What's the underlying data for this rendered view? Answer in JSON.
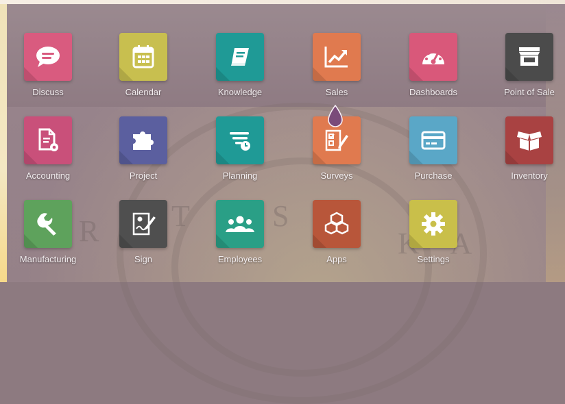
{
  "apps": [
    {
      "label": "Discuss",
      "icon": "chat-bubble-icon",
      "color": "#d95b7f"
    },
    {
      "label": "Calendar",
      "icon": "calendar-icon",
      "color": "#c8bf4f"
    },
    {
      "label": "Knowledge",
      "icon": "book-icon",
      "color": "#1f9a96"
    },
    {
      "label": "Sales",
      "icon": "chart-trend-icon",
      "color": "#e07a4f"
    },
    {
      "label": "Dashboards",
      "icon": "gauge-icon",
      "color": "#d9587a"
    },
    {
      "label": "Point of Sale",
      "icon": "store-icon",
      "color": "#4b4b4b"
    },
    {
      "label": "Accounting",
      "icon": "document-gear-icon",
      "color": "#c9507a"
    },
    {
      "label": "Project",
      "icon": "puzzle-icon",
      "color": "#5b5f9f"
    },
    {
      "label": "Planning",
      "icon": "planning-icon",
      "color": "#1f9a96"
    },
    {
      "label": "Surveys",
      "icon": "checklist-icon",
      "color": "#e07a4f"
    },
    {
      "label": "Purchase",
      "icon": "credit-card-icon",
      "color": "#5aa7c7"
    },
    {
      "label": "Inventory",
      "icon": "box-icon",
      "color": "#a94242"
    },
    {
      "label": "Manufacturing",
      "icon": "wrench-icon",
      "color": "#5ea25c"
    },
    {
      "label": "Sign",
      "icon": "sign-document-icon",
      "color": "#4f4f4f"
    },
    {
      "label": "Employees",
      "icon": "people-icon",
      "color": "#2a9f86"
    },
    {
      "label": "Apps",
      "icon": "cubes-icon",
      "color": "#b8563a"
    },
    {
      "label": "Settings",
      "icon": "gear-icon",
      "color": "#c9bf4a"
    }
  ],
  "watermark": {
    "text_left": "R S",
    "text_center": "T A S",
    "text_right": "K A"
  }
}
